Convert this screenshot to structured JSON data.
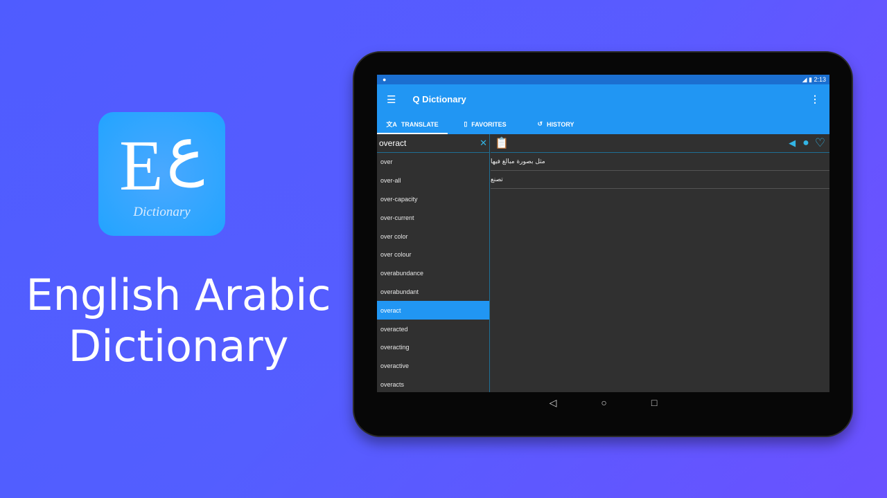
{
  "promo": {
    "logo_letters": "Eع",
    "logo_sub": "Dictionary",
    "title_line1": "English Arabic",
    "title_line2": "Dictionary"
  },
  "status": {
    "time": "2:13"
  },
  "toolbar": {
    "title": "Q Dictionary"
  },
  "tabs": [
    {
      "label": "TRANSLATE",
      "icon": "translate-icon"
    },
    {
      "label": "FAVORITES",
      "icon": "bookmark-icon"
    },
    {
      "label": "HISTORY",
      "icon": "history-icon"
    }
  ],
  "search": {
    "value": "overact"
  },
  "words": [
    "over",
    "over-all",
    "over-capacity",
    "over-current",
    "over color",
    "over colour",
    "overabundance",
    "overabundant",
    "overact",
    "overacted",
    "overacting",
    "overactive",
    "overacts"
  ],
  "selected_word": "overact",
  "translations": [
    "مثل بصورة مبالغ فيها",
    "تصنع"
  ],
  "colors": {
    "accent": "#2196f3",
    "status_bar": "#1b6fd0",
    "icon": "#33b5e5",
    "panel": "#303030"
  }
}
